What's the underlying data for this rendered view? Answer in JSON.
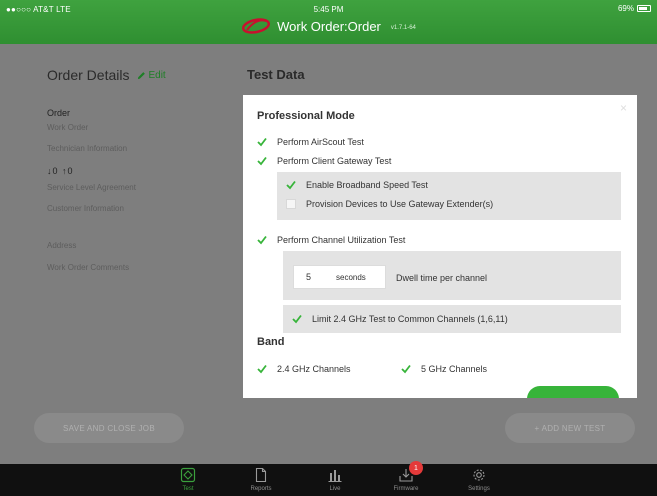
{
  "status_bar": {
    "carrier": "●●○○○ AT&T  LTE",
    "time": "5:45 PM",
    "battery": "69%"
  },
  "header": {
    "title": "Work Order:Order",
    "version": "v1.7.1-64"
  },
  "left_panel": {
    "title": "Order Details",
    "edit_label": "Edit",
    "items": {
      "order": "Order",
      "work_order": "Work Order",
      "technician": "Technician Information",
      "arrows": "↓0  ↑0",
      "sla": "Service Level Agreement",
      "customer": "Customer Information",
      "address": "Address",
      "comments": "Work Order Comments"
    },
    "save_button": "SAVE AND CLOSE JOB",
    "add_test_button": "+ ADD NEW TEST"
  },
  "main": {
    "section_title": "Test Data",
    "modal": {
      "close": "×",
      "title": "Professional Mode",
      "options": {
        "airscout": "Perform AirScout Test",
        "client_gateway": "Perform Client Gateway Test",
        "broadband": "Enable Broadband Speed Test",
        "provision": "Provision Devices to Use Gateway Extender(s)",
        "channel_util": "Perform Channel Utilization Test",
        "limit_24": "Limit 2.4 GHz Test to Common Channels (1,6,11)"
      },
      "dwell": {
        "value": "5",
        "unit": "seconds",
        "label": "Dwell time per channel"
      },
      "band_title": "Band",
      "band": {
        "ghz24": "2.4 GHz Channels",
        "ghz5": "5 GHz Channels"
      }
    }
  },
  "tabbar": {
    "tabs": [
      "Test",
      "Reports",
      "Live",
      "Firmware",
      "Settings"
    ],
    "firmware_badge": "1"
  },
  "colors": {
    "accent": "#37b43a",
    "header": "#339a35",
    "background": "#7e7e7e"
  }
}
